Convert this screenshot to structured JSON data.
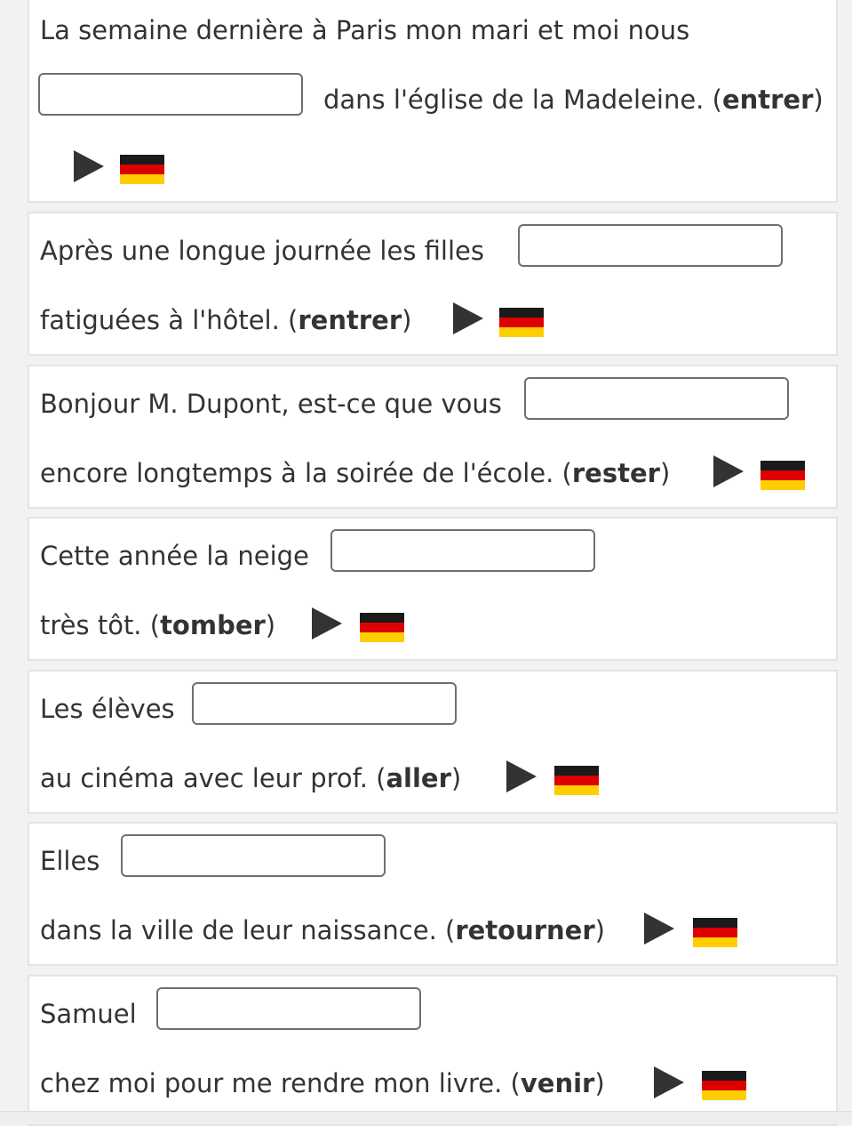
{
  "exercises": [
    {
      "before": "La semaine dernière à Paris mon mari et moi nous",
      "after": "dans l'église de la Madeleine. (",
      "verb": "entrer",
      "close": ")",
      "answer": ""
    },
    {
      "before": "Après une longue journée les filles",
      "after": "fatiguées à l'hôtel. (",
      "verb": "rentrer",
      "close": ")",
      "answer": ""
    },
    {
      "before": "Bonjour M. Dupont, est-ce que vous",
      "after": "encore longtemps à la soirée de l'école. (",
      "verb": "rester",
      "close": ")",
      "answer": ""
    },
    {
      "before": "Cette année la neige",
      "after": "très tôt. (",
      "verb": "tomber",
      "close": ")",
      "answer": ""
    },
    {
      "before": "Les élèves",
      "after": "au cinéma avec leur prof. (",
      "verb": "aller",
      "close": ")",
      "answer": ""
    },
    {
      "before": "Elles",
      "after": "dans la ville de leur naissance. (",
      "verb": "retourner",
      "close": ")",
      "answer": ""
    },
    {
      "before": "Samuel",
      "after": "chez moi pour me rendre mon livre. (",
      "verb": "venir",
      "close": ")",
      "answer": ""
    }
  ],
  "icons": {
    "play": "play-icon",
    "translation": "german-flag-icon"
  },
  "colors": {
    "text": "#333333",
    "border": "#e4e4e4",
    "input_border": "#6f6f6f",
    "flag": [
      "#1a1a1a",
      "#dd0000",
      "#ffce00"
    ]
  }
}
